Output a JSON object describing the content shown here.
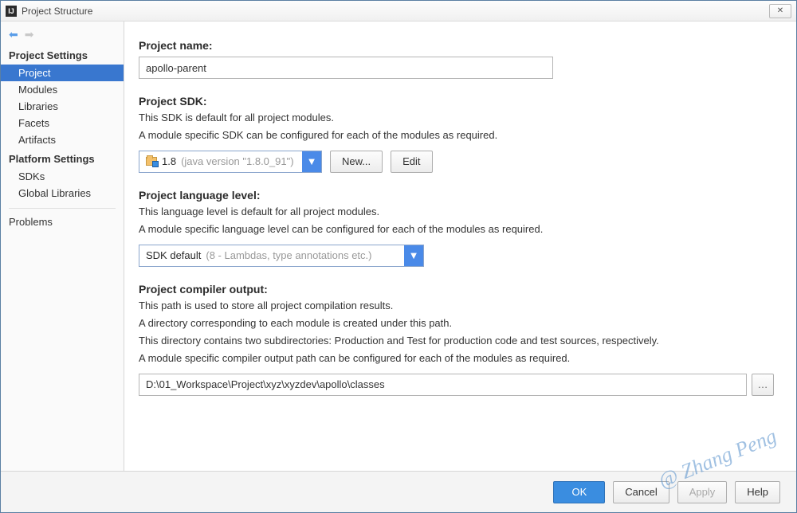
{
  "window": {
    "title": "Project Structure",
    "close_glyph": "✕"
  },
  "sidebar": {
    "heading_project": "Project Settings",
    "heading_platform": "Platform Settings",
    "items_project": [
      {
        "label": "Project",
        "selected": true
      },
      {
        "label": "Modules"
      },
      {
        "label": "Libraries"
      },
      {
        "label": "Facets"
      },
      {
        "label": "Artifacts"
      }
    ],
    "items_platform": [
      {
        "label": "SDKs"
      },
      {
        "label": "Global Libraries"
      }
    ],
    "problems": "Problems"
  },
  "main": {
    "project_name_label": "Project name:",
    "project_name_value": "apollo-parent",
    "sdk_label": "Project SDK:",
    "sdk_desc1": "This SDK is default for all project modules.",
    "sdk_desc2": "A module specific SDK can be configured for each of the modules as required.",
    "sdk_value_main": "1.8",
    "sdk_value_dim": "(java version \"1.8.0_91\")",
    "new_btn": "New...",
    "edit_btn": "Edit",
    "lang_label": "Project language level:",
    "lang_desc1": "This language level is default for all project modules.",
    "lang_desc2": "A module specific language level can be configured for each of the modules as required.",
    "lang_value_main": "SDK default",
    "lang_value_dim": "(8 - Lambdas, type annotations etc.)",
    "compiler_label": "Project compiler output:",
    "compiler_desc1": "This path is used to store all project compilation results.",
    "compiler_desc2": "A directory corresponding to each module is created under this path.",
    "compiler_desc3": "This directory contains two subdirectories: Production and Test for production code and test sources, respectively.",
    "compiler_desc4": "A module specific compiler output path can be configured for each of the modules as required.",
    "compiler_path": "D:\\01_Workspace\\Project\\xyz\\xyzdev\\apollo\\classes"
  },
  "footer": {
    "ok": "OK",
    "cancel": "Cancel",
    "apply": "Apply",
    "help": "Help"
  },
  "watermark": "@ Zhang Peng"
}
